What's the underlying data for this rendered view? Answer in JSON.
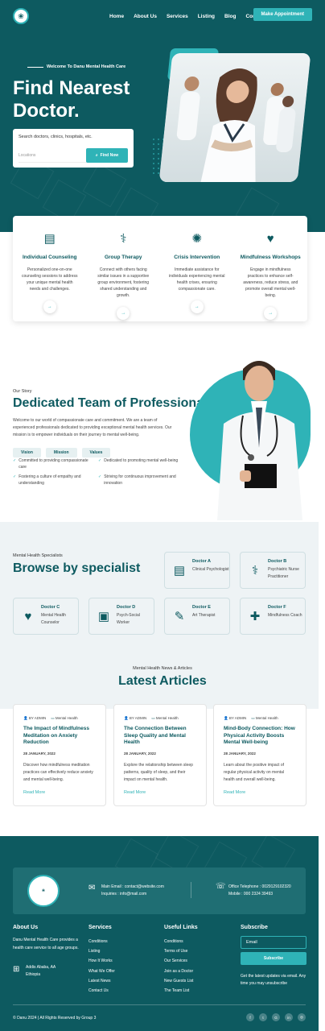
{
  "nav": {
    "items": [
      "Home",
      "About Us",
      "Services",
      "Listing",
      "Blog",
      "Contact"
    ],
    "cta": "Make Appointment"
  },
  "hero": {
    "kicker": "Welcome To Danu Mental Health Care",
    "title": "Find Nearest Doctor.",
    "search_label": "Search doctors, clinics, hospitals, etc.",
    "location_placeholder": "Locations",
    "find_button": "Find Now"
  },
  "services": [
    {
      "title": "Individual Counseling",
      "desc": "Personalized one-on-one counseling sessions to address your unique mental health needs and challenges.",
      "icon": "clipboard-icon"
    },
    {
      "title": "Group Therapy",
      "desc": "Connect with others facing similar issues in a supportive group environment, fostering shared understanding and growth.",
      "icon": "stethoscope-icon"
    },
    {
      "title": "Crisis Intervention",
      "desc": "Immediate assistance for individuals experiencing mental health crises, ensuring compassionate care.",
      "icon": "brain-icon"
    },
    {
      "title": "Mindfulness Workshops",
      "desc": "Engage in mindfulness practices to enhance self-awareness, reduce stress, and promote overall mental well-being.",
      "icon": "heartbeat-icon"
    }
  ],
  "story": {
    "kicker": "Our Story",
    "title": "Dedicated Team of Professionals",
    "text": "Welcome to our world of compassionate care and commitment. We are a team of experienced professionals dedicated to providing exceptional mental health services. Our mission is to empower individuals on their journey to mental well-being.",
    "tabs": [
      "Vision",
      "Mission",
      "Values"
    ],
    "checks": [
      "Committed to providing compassionate care",
      "Dedicated to promoting mental well-being",
      "Fostering a culture of empathy and understanding",
      "Striving for continuous improvement and innovation"
    ]
  },
  "specialists": {
    "kicker": "Mental Health Specialists",
    "title": "Browse by specialist",
    "items": [
      {
        "name": "Doctor A",
        "role": "Clinical Psychologist"
      },
      {
        "name": "Doctor B",
        "role": "Psychiatric Nurse Practitioner"
      },
      {
        "name": "Doctor C",
        "role": "Mental Health Counselor"
      },
      {
        "name": "Doctor D",
        "role": "Psych-Social Worker"
      },
      {
        "name": "Doctor E",
        "role": "Art Therapist"
      },
      {
        "name": "Doctor F",
        "role": "Mindfulness Coach"
      }
    ]
  },
  "articles": {
    "kicker": "Mental Health News & Articles",
    "title": "Latest Articles",
    "items": [
      {
        "author": "BY ADMIN",
        "cat": "Mental Health",
        "title": "The Impact of Mindfulness Meditation on Anxiety Reduction",
        "date": "28 JANUARY, 2022",
        "desc": "Discover how mindfulness meditation practices can effectively reduce anxiety and mental well-being.",
        "more": "Read More"
      },
      {
        "author": "BY ADMIN",
        "cat": "Mental Health",
        "title": "The Connection Between Sleep Quality and Mental Health",
        "date": "28 JANUARY, 2022",
        "desc": "Explore the relationship between sleep patterns, quality of sleep, and their impact on mental health.",
        "more": "Read More"
      },
      {
        "author": "BY ADMIN",
        "cat": "Mental Health",
        "title": "Mind-Body Connection: How Physical Activity Boosts Mental Well-being",
        "date": "28 JANUARY, 2022",
        "desc": "Learn about the positive impact of regular physical activity on mental health and overall well-being.",
        "more": "Read More"
      }
    ]
  },
  "footer": {
    "main_email": "Main Email : contact@website.com",
    "inquiries": "Inquiries : info@mail.com",
    "office_phone": "Office Telephone : 0029129102320",
    "mobile": "Mobile : 000 2324 39493",
    "about_title": "About Us",
    "about_text": "Danu Mental Health Care provides a health care service to all age groups.",
    "address": "Addis Ababa, AA Ethiopia",
    "services_title": "Services",
    "services_links": [
      "Conditions",
      "Listing",
      "How It Works",
      "What We Offer",
      "Latest News",
      "Contact Us"
    ],
    "useful_title": "Useful Links",
    "useful_links": [
      "Conditions",
      "Terms of Use",
      "Our Services",
      "Join as a Doctor",
      "New Guests List",
      "The Team List"
    ],
    "subscribe_title": "Subscribe",
    "email_placeholder": "Email",
    "subscribe_button": "Subscribe",
    "subscribe_note": "Get the latest updates via email. Any time you may unsubscribe",
    "copyright": "© Danu 2024 | All Rights Reserved by Group 3",
    "socials": [
      "facebook-icon",
      "twitter-icon",
      "google-icon",
      "linkedin-icon",
      "instagram-icon"
    ]
  }
}
